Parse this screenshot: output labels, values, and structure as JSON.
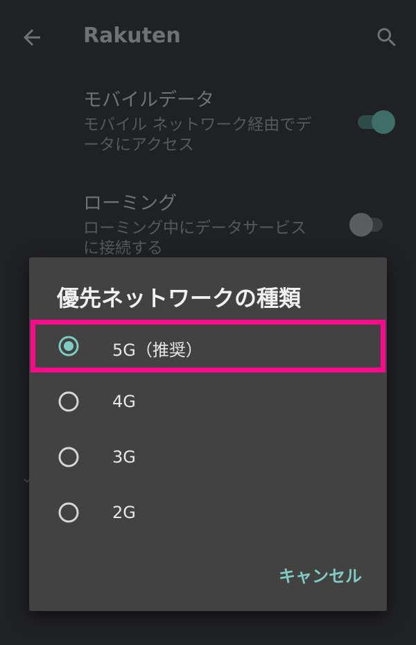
{
  "colors": {
    "accent": "#80cbc4",
    "highlight_border": "#ff0a8a",
    "dialog_background": "#424242",
    "screen_background": "#202124"
  },
  "appbar": {
    "title": "Rakuten",
    "back_icon": "arrow-back-icon",
    "search_icon": "search-icon"
  },
  "settings": {
    "mobile_data": {
      "title": "モバイルデータ",
      "summary": "モバイル ネットワーク経由でデータにアクセス",
      "enabled": true
    },
    "roaming": {
      "title": "ローミング",
      "summary": "ローミング中にデータサービスに接続する",
      "enabled": false
    }
  },
  "dialog": {
    "title": "優先ネットワークの種類",
    "options": [
      {
        "label": "5G（推奨）",
        "selected": true
      },
      {
        "label": "4G",
        "selected": false
      },
      {
        "label": "3G",
        "selected": false
      },
      {
        "label": "2G",
        "selected": false
      }
    ],
    "cancel_label": "キャンセル"
  }
}
